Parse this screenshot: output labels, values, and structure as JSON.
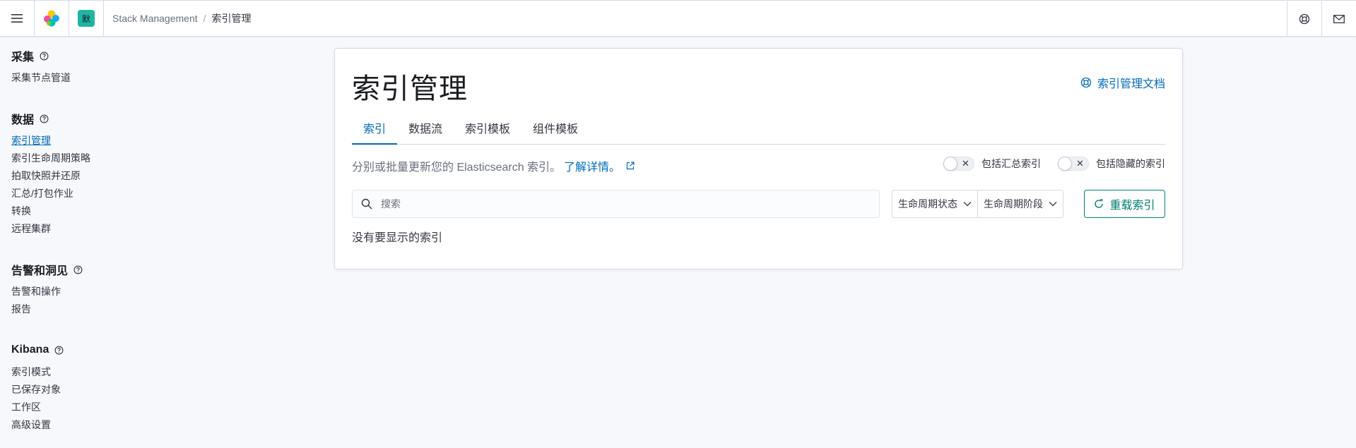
{
  "header": {
    "space_initial": "默",
    "breadcrumbs": [
      "Stack Management",
      "索引管理"
    ]
  },
  "sidebar": {
    "groups": [
      {
        "title": "采集",
        "items": [
          "采集节点管道"
        ]
      },
      {
        "title": "数据",
        "items": [
          "索引管理",
          "索引生命周期策略",
          "拍取快照并还原",
          "汇总/打包作业",
          "转换",
          "远程集群"
        ]
      },
      {
        "title": "告警和洞见",
        "items": [
          "告警和操作",
          "报告"
        ]
      },
      {
        "title": "Kibana",
        "items": [
          "索引模式",
          "已保存对象",
          "工作区",
          "高级设置"
        ]
      }
    ],
    "active_item": "索引管理"
  },
  "main": {
    "title": "索引管理",
    "docs_link": "索引管理文档",
    "tabs": [
      "索引",
      "数据流",
      "索引模板",
      "组件模板"
    ],
    "active_tab": "索引",
    "description": "分别或批量更新您的 Elasticsearch 索引。",
    "learn_more": "了解详情。",
    "switches": [
      {
        "label": "包括汇总索引",
        "on": false
      },
      {
        "label": "包括隐藏的索引",
        "on": false
      }
    ],
    "search_placeholder": "搜索",
    "filters": [
      "生命周期状态",
      "生命周期阶段"
    ],
    "reload_button": "重载索引",
    "empty_message": "没有要显示的索引"
  },
  "colors": {
    "link": "#006bb8",
    "primary_button": "#017d73",
    "space_avatar": "#20b5a3"
  }
}
